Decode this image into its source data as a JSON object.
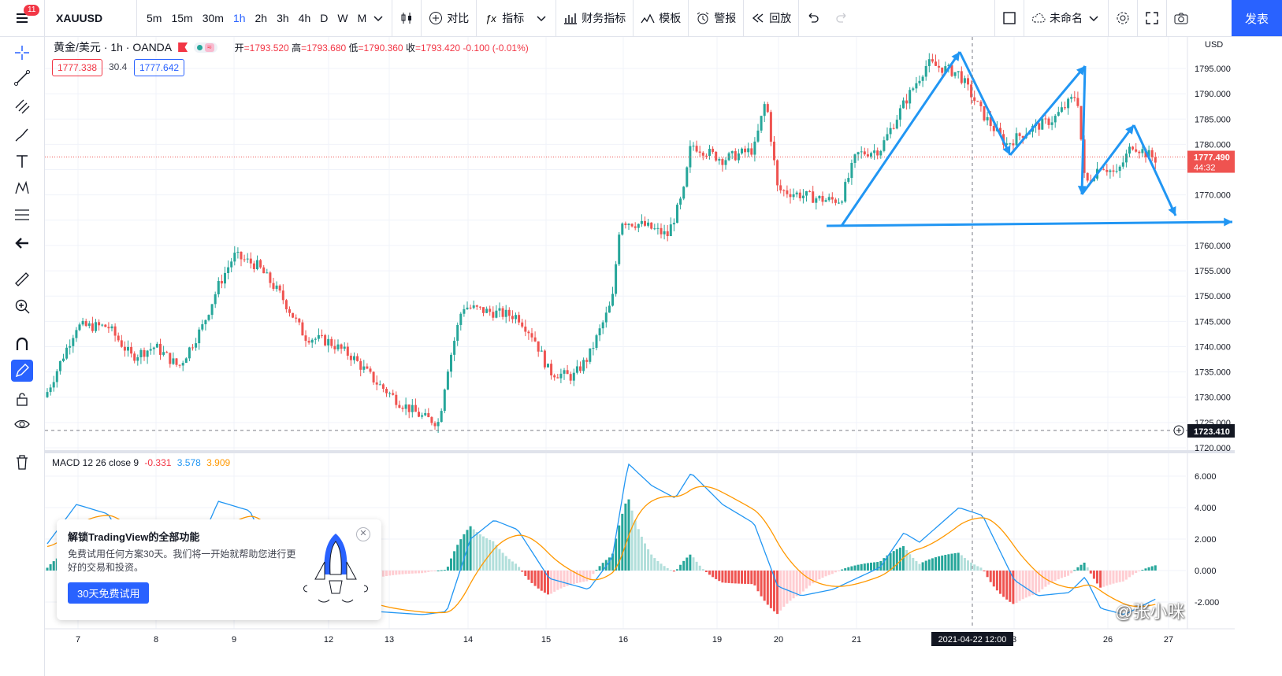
{
  "header": {
    "menu_badge": "11",
    "symbol": "XAUUSD",
    "timeframes": [
      "5m",
      "15m",
      "30m",
      "1h",
      "2h",
      "3h",
      "4h",
      "D",
      "W",
      "M"
    ],
    "active_timeframe": "1h",
    "compare_label": "对比",
    "indicators_label": "指标",
    "financials_label": "财务指标",
    "templates_label": "模板",
    "alert_label": "警报",
    "replay_label": "回放",
    "layout_name": "未命名",
    "publish_label": "发表"
  },
  "legend": {
    "instrument": "黄金/美元 · 1h · OANDA",
    "open_label": "开",
    "open": "1793.520",
    "high_label": "高",
    "high": "1793.680",
    "low_label": "低",
    "low": "1790.360",
    "close_label": "收",
    "close": "1793.420",
    "change": "-0.100 (-0.01%)",
    "bid": "1777.338",
    "spread": "30.4",
    "ask": "1777.642"
  },
  "price_axis": {
    "currency": "USD",
    "ticks": [
      "1795.000",
      "1790.000",
      "1785.000",
      "1780.000",
      "1770.000",
      "1760.000",
      "1755.000",
      "1750.000",
      "1745.000",
      "1740.000",
      "1735.000",
      "1730.000",
      "1725.000",
      "1720.000"
    ],
    "last_price": "1777.490",
    "countdown": "44:32",
    "crosshair_price": "1723.410"
  },
  "time_axis": {
    "labels": [
      "7",
      "8",
      "9",
      "12",
      "13",
      "14",
      "15",
      "16",
      "19",
      "20",
      "21",
      "3",
      "26",
      "27"
    ],
    "crosshair_time": "2021-04-22   12:00"
  },
  "macd": {
    "title": "MACD 12 26 close 9",
    "hist": "-0.331",
    "macd": "3.578",
    "signal": "3.909",
    "ticks": [
      "6.000",
      "4.000",
      "2.000",
      "0.000",
      "-2.000"
    ]
  },
  "promo": {
    "title": "解锁TradingView的全部功能",
    "desc": "免费试用任何方案30天。我们将一开始就帮助您进行更好的交易和投资。",
    "button": "30天免费试用"
  },
  "watermark": "@张小咪",
  "colors": {
    "up": "#26a69a",
    "down": "#ef5350",
    "accent": "#2962ff",
    "annotation": "#2196f3",
    "macd_line": "#2196f3",
    "signal_line": "#ff9800"
  }
}
